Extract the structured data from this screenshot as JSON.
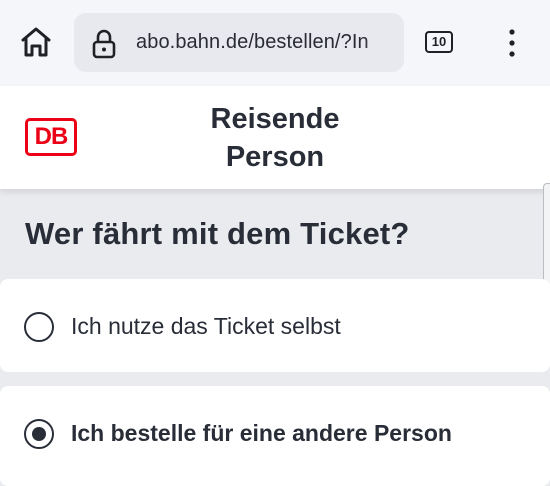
{
  "browser": {
    "url": "abo.bahn.de/bestellen/?In",
    "tab_count": "10",
    "home_icon": "home-icon",
    "lock_icon": "lock-icon",
    "menu_icon": "more-vert-icon"
  },
  "header": {
    "logo_text": "DB",
    "title_line1": "Reisende",
    "title_line2": "Person"
  },
  "question": {
    "heading": "Wer fährt mit dem Ticket?"
  },
  "options": [
    {
      "label": "Ich nutze das Ticket selbst",
      "selected": false
    },
    {
      "label": "Ich bestelle für eine andere Person",
      "selected": true
    }
  ],
  "colors": {
    "db_red": "#ec0016",
    "text": "#282d37",
    "background": "#e9ebee"
  }
}
